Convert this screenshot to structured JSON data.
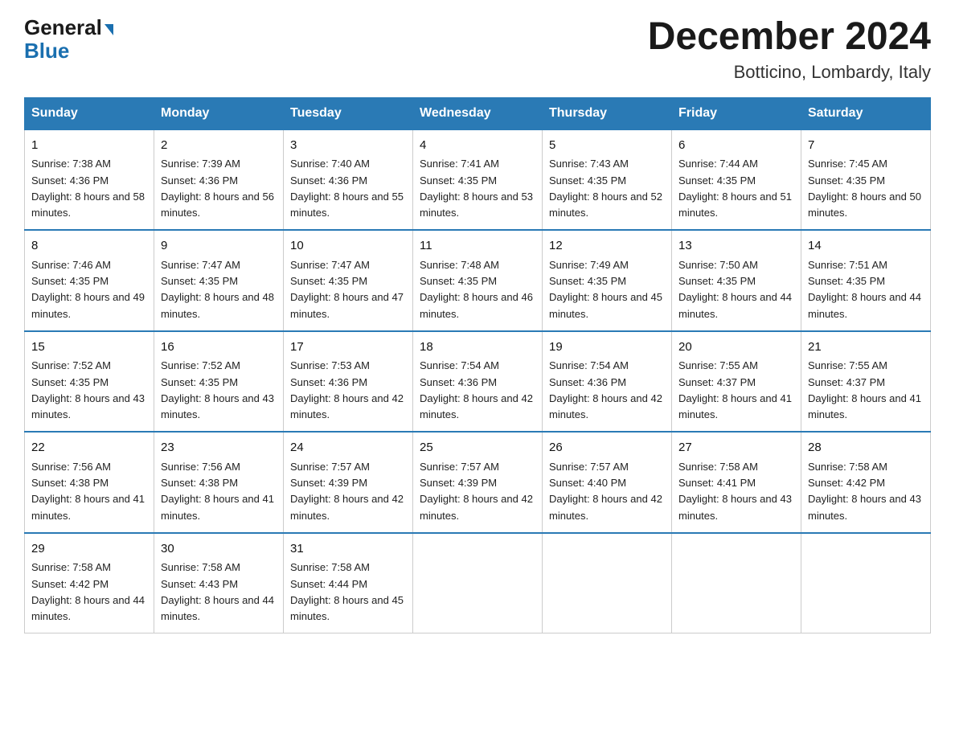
{
  "header": {
    "logo_general": "General",
    "logo_blue": "Blue",
    "month_title": "December 2024",
    "location": "Botticino, Lombardy, Italy"
  },
  "days_of_week": [
    "Sunday",
    "Monday",
    "Tuesday",
    "Wednesday",
    "Thursday",
    "Friday",
    "Saturday"
  ],
  "weeks": [
    [
      {
        "day": "1",
        "sunrise": "7:38 AM",
        "sunset": "4:36 PM",
        "daylight": "8 hours and 58 minutes."
      },
      {
        "day": "2",
        "sunrise": "7:39 AM",
        "sunset": "4:36 PM",
        "daylight": "8 hours and 56 minutes."
      },
      {
        "day": "3",
        "sunrise": "7:40 AM",
        "sunset": "4:36 PM",
        "daylight": "8 hours and 55 minutes."
      },
      {
        "day": "4",
        "sunrise": "7:41 AM",
        "sunset": "4:35 PM",
        "daylight": "8 hours and 53 minutes."
      },
      {
        "day": "5",
        "sunrise": "7:43 AM",
        "sunset": "4:35 PM",
        "daylight": "8 hours and 52 minutes."
      },
      {
        "day": "6",
        "sunrise": "7:44 AM",
        "sunset": "4:35 PM",
        "daylight": "8 hours and 51 minutes."
      },
      {
        "day": "7",
        "sunrise": "7:45 AM",
        "sunset": "4:35 PM",
        "daylight": "8 hours and 50 minutes."
      }
    ],
    [
      {
        "day": "8",
        "sunrise": "7:46 AM",
        "sunset": "4:35 PM",
        "daylight": "8 hours and 49 minutes."
      },
      {
        "day": "9",
        "sunrise": "7:47 AM",
        "sunset": "4:35 PM",
        "daylight": "8 hours and 48 minutes."
      },
      {
        "day": "10",
        "sunrise": "7:47 AM",
        "sunset": "4:35 PM",
        "daylight": "8 hours and 47 minutes."
      },
      {
        "day": "11",
        "sunrise": "7:48 AM",
        "sunset": "4:35 PM",
        "daylight": "8 hours and 46 minutes."
      },
      {
        "day": "12",
        "sunrise": "7:49 AM",
        "sunset": "4:35 PM",
        "daylight": "8 hours and 45 minutes."
      },
      {
        "day": "13",
        "sunrise": "7:50 AM",
        "sunset": "4:35 PM",
        "daylight": "8 hours and 44 minutes."
      },
      {
        "day": "14",
        "sunrise": "7:51 AM",
        "sunset": "4:35 PM",
        "daylight": "8 hours and 44 minutes."
      }
    ],
    [
      {
        "day": "15",
        "sunrise": "7:52 AM",
        "sunset": "4:35 PM",
        "daylight": "8 hours and 43 minutes."
      },
      {
        "day": "16",
        "sunrise": "7:52 AM",
        "sunset": "4:35 PM",
        "daylight": "8 hours and 43 minutes."
      },
      {
        "day": "17",
        "sunrise": "7:53 AM",
        "sunset": "4:36 PM",
        "daylight": "8 hours and 42 minutes."
      },
      {
        "day": "18",
        "sunrise": "7:54 AM",
        "sunset": "4:36 PM",
        "daylight": "8 hours and 42 minutes."
      },
      {
        "day": "19",
        "sunrise": "7:54 AM",
        "sunset": "4:36 PM",
        "daylight": "8 hours and 42 minutes."
      },
      {
        "day": "20",
        "sunrise": "7:55 AM",
        "sunset": "4:37 PM",
        "daylight": "8 hours and 41 minutes."
      },
      {
        "day": "21",
        "sunrise": "7:55 AM",
        "sunset": "4:37 PM",
        "daylight": "8 hours and 41 minutes."
      }
    ],
    [
      {
        "day": "22",
        "sunrise": "7:56 AM",
        "sunset": "4:38 PM",
        "daylight": "8 hours and 41 minutes."
      },
      {
        "day": "23",
        "sunrise": "7:56 AM",
        "sunset": "4:38 PM",
        "daylight": "8 hours and 41 minutes."
      },
      {
        "day": "24",
        "sunrise": "7:57 AM",
        "sunset": "4:39 PM",
        "daylight": "8 hours and 42 minutes."
      },
      {
        "day": "25",
        "sunrise": "7:57 AM",
        "sunset": "4:39 PM",
        "daylight": "8 hours and 42 minutes."
      },
      {
        "day": "26",
        "sunrise": "7:57 AM",
        "sunset": "4:40 PM",
        "daylight": "8 hours and 42 minutes."
      },
      {
        "day": "27",
        "sunrise": "7:58 AM",
        "sunset": "4:41 PM",
        "daylight": "8 hours and 43 minutes."
      },
      {
        "day": "28",
        "sunrise": "7:58 AM",
        "sunset": "4:42 PM",
        "daylight": "8 hours and 43 minutes."
      }
    ],
    [
      {
        "day": "29",
        "sunrise": "7:58 AM",
        "sunset": "4:42 PM",
        "daylight": "8 hours and 44 minutes."
      },
      {
        "day": "30",
        "sunrise": "7:58 AM",
        "sunset": "4:43 PM",
        "daylight": "8 hours and 44 minutes."
      },
      {
        "day": "31",
        "sunrise": "7:58 AM",
        "sunset": "4:44 PM",
        "daylight": "8 hours and 45 minutes."
      },
      null,
      null,
      null,
      null
    ]
  ]
}
